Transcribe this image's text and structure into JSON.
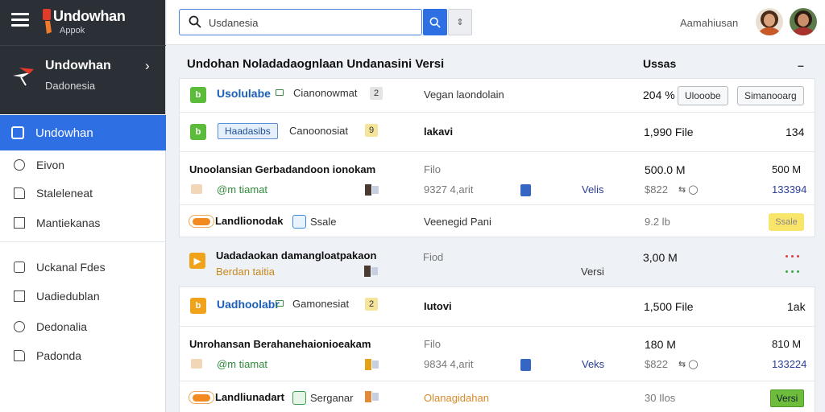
{
  "app": {
    "title": "Undowhan",
    "subtitle": "Appok"
  },
  "workspace": {
    "name": "Undowhan",
    "sub": "Dadonesia"
  },
  "nav": {
    "active": "Undowhan",
    "items": [
      "Eivon",
      "Staleleneat",
      "Mantiekanas",
      "Uckanal Fdes",
      "Uadiedublan",
      "Dedonalia",
      "Padonda"
    ]
  },
  "search": {
    "value": "Usdanesia"
  },
  "account": {
    "name": "Aamahiusan"
  },
  "panel": {
    "title": "Undohan Noladadaognlaan Undanasini Versi",
    "status_header": "Ussas",
    "minimize": "–"
  },
  "rows": [
    {
      "name": "Usolulabe",
      "chip1": "Cianonowmat",
      "chip2": "2",
      "desc": "Vegan laondolain",
      "value": "204 %",
      "btn1": "Ulooobe",
      "btn2": "Simanooarg"
    },
    {
      "badge": "Haadasibs",
      "label": "Canoonosiat",
      "chip": "9",
      "col": "lakavi",
      "value": "1,990 File",
      "right": "134"
    },
    {
      "title": "Unoolansian Gerbadandoon ionokam",
      "chip": "@m tiamat",
      "col1": "Filo",
      "col2": "9327 4,arit",
      "mid": "Velis",
      "val1": "500.0 M",
      "val2": "$822",
      "right1": "500 M",
      "right2": "133394"
    },
    {
      "name": "Landlionodak",
      "chip": "Ssale",
      "col": "Veenegid Pani",
      "value": "9.2 lb",
      "tag": "Ssale"
    },
    {
      "title": "Uadadaokan damangloatpakaon",
      "sub": "Berdan taitia",
      "col": "Fiod",
      "mid": "Versi",
      "value": "3,00 M"
    },
    {
      "name": "Uadhoolabr",
      "chip1": "Gamonesiat",
      "chip2": "2",
      "col": "Iutovi",
      "value": "1,500 File",
      "right": "1ak"
    },
    {
      "title": "Unrohansan Berahanehaionioeakam",
      "chip": "@m tiamat",
      "col1": "Filo",
      "col2": "9834 4,arit",
      "mid": "Veks",
      "val1": "180 M",
      "val2": "$822",
      "right1": "810 M",
      "right2": "133224"
    },
    {
      "name": "Landliunadart",
      "chip": "Serganar",
      "col": "Olanagidahan",
      "value": "30 Ilos",
      "tag": "Versi"
    }
  ],
  "colors": {
    "accent": "#2f6fe4",
    "sidebar_dark": "#2b2f36",
    "green": "#5bbb3a",
    "orange": "#f0a21b"
  },
  "icons": [
    "menu-icon",
    "flag-logo-icon",
    "chevron-right-icon",
    "search-icon",
    "dropdown-icon"
  ]
}
